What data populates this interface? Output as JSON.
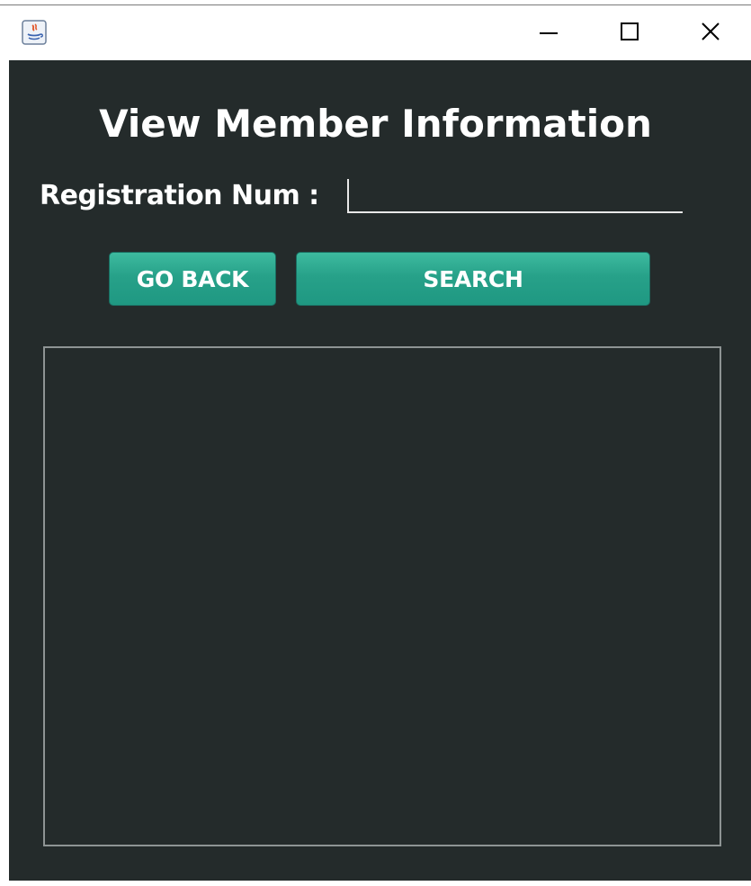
{
  "titlebar": {
    "app_icon": "java-icon",
    "minimize_icon": "minimize-icon",
    "maximize_icon": "maximize-icon",
    "close_icon": "close-icon"
  },
  "form": {
    "title": "View Member Information",
    "registration_label": "Registration Num :",
    "registration_value": "",
    "go_back_label": "GO BACK",
    "search_label": "SEARCH"
  },
  "colors": {
    "background": "#242b2b",
    "button": "#27a189",
    "text": "#ffffff"
  }
}
